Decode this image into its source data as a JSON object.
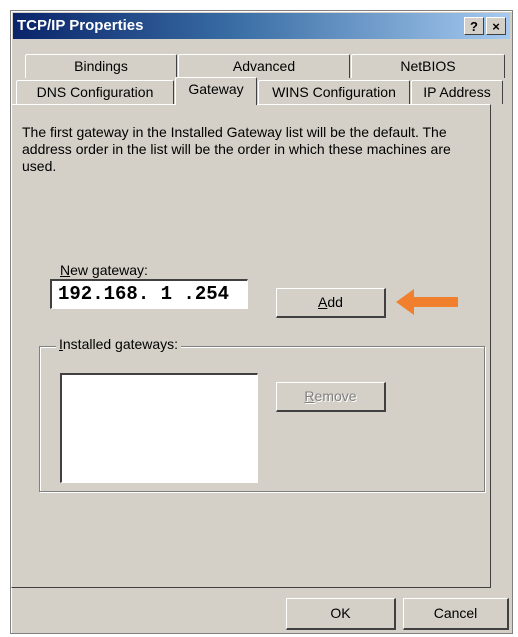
{
  "window": {
    "title": "TCP/IP Properties",
    "help_button": "?",
    "close_button": "×"
  },
  "tabs": {
    "row1": [
      "Bindings",
      "Advanced",
      "NetBIOS"
    ],
    "row2": [
      "DNS Configuration",
      "Gateway",
      "WINS Configuration",
      "IP Address"
    ],
    "active": "Gateway"
  },
  "gateway": {
    "description": "The first gateway in the Installed Gateway list will be the default. The address order in the list will be the order in which these machines are used.",
    "new_gateway_label_prefix": "N",
    "new_gateway_label_rest": "ew gateway:",
    "ip_value": "192.168. 1 .254",
    "add_button_prefix": "A",
    "add_button_rest": "dd",
    "installed_label_prefix": "I",
    "installed_label_rest": "nstalled gateways:",
    "remove_button_prefix": "R",
    "remove_button_rest": "emove",
    "installed_gateways": []
  },
  "footer": {
    "ok_label": "OK",
    "cancel_label": "Cancel"
  },
  "colors": {
    "dialog_bg": "#d4d0c8",
    "titlebar_start": "#0a246a",
    "titlebar_end": "#a6caf0",
    "arrow": "#f07f2e"
  },
  "icons": {
    "arrow": "left-arrow-icon"
  }
}
